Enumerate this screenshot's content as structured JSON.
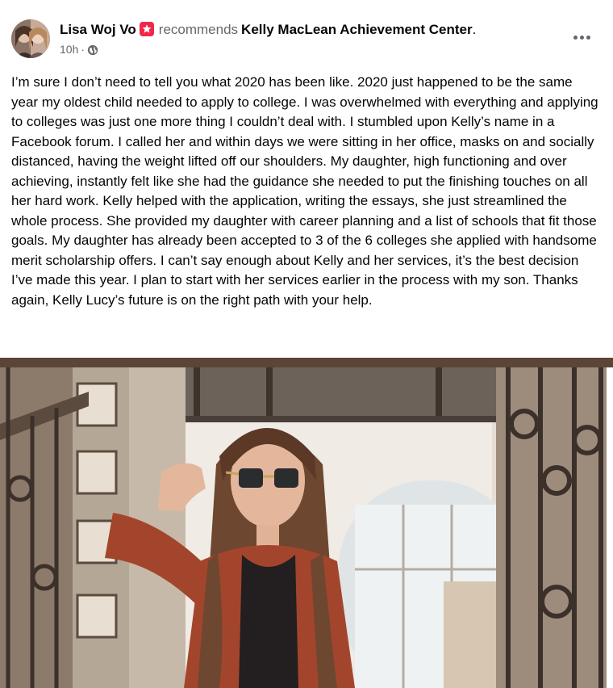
{
  "post": {
    "author": "Lisa Woj Vo",
    "verb": "recommends",
    "page_name": "Kelly MacLean Achievement Center",
    "page_suffix": ".",
    "time": "10h",
    "time_separator": "·",
    "privacy_icon": "globe-icon",
    "recommend_icon": "recommend-badge-icon",
    "more_icon": "more-horizontal-icon",
    "text": "I’m sure I don’t need to tell you what 2020 has been like. 2020 just happened to be the same year my oldest child needed to apply to college. I was overwhelmed with everything and applying to colleges was just one more thing I couldn’t deal with. I stumbled upon Kelly’s name in a Facebook forum. I called her and within days we were sitting in her office, masks on and socially distanced, having the weight lifted off our shoulders. My daughter, high functioning and over achieving, instantly felt like she had the guidance she needed to put the finishing touches on all her hard work.  Kelly helped with the application, writing the essays, she just streamlined the whole process. She provided my daughter with career planning and a list of schools that fit those goals. My daughter has already been accepted to 3 of the 6 colleges she applied with handsome merit scholarship offers. I can’t say enough about Kelly and her services, it’s the best decision I’ve made this year. I plan to start with her services earlier in the process with my son. Thanks again, Kelly Lucy’s future is on the right path with your help."
  },
  "colors": {
    "badge": "#f02849",
    "secondary_text": "#65676b",
    "primary_text": "#050505"
  }
}
